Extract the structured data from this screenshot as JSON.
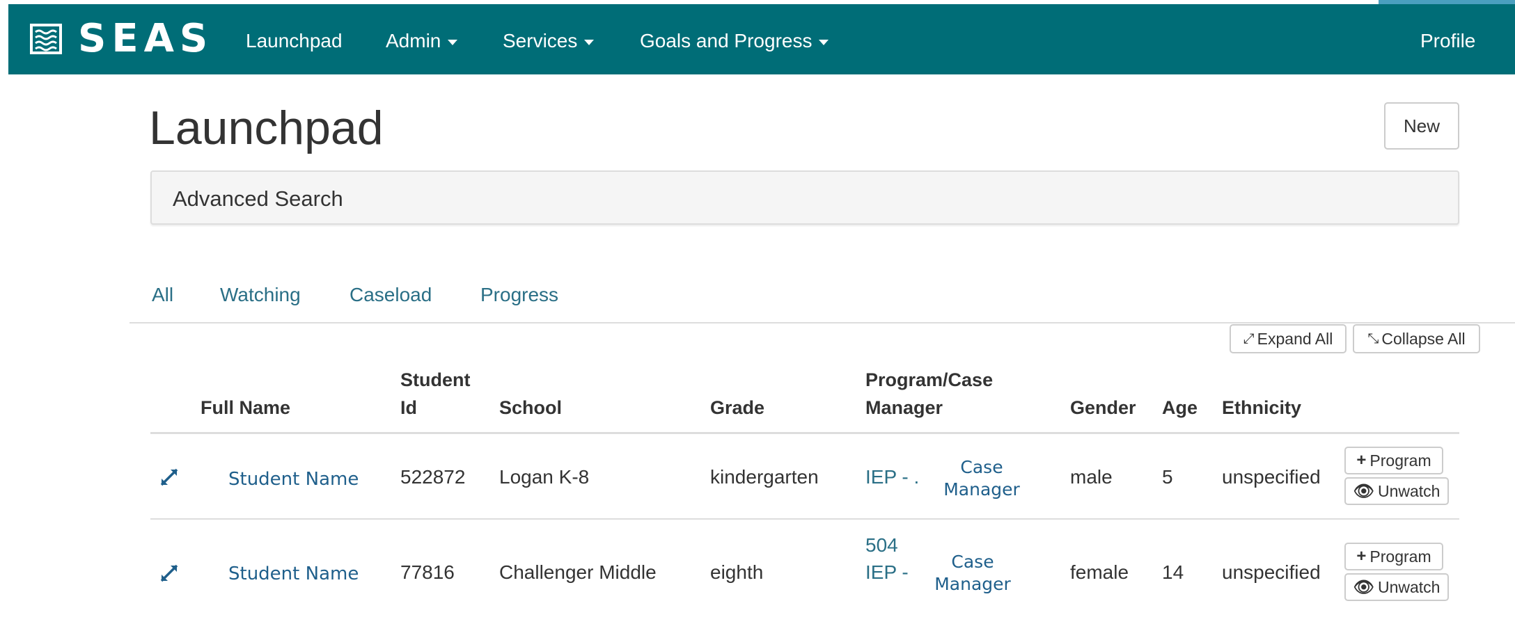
{
  "navbar": {
    "brand": "SEAS",
    "items": [
      {
        "label": "Launchpad"
      },
      {
        "label": "Admin"
      },
      {
        "label": "Services"
      },
      {
        "label": "Goals and Progress"
      }
    ],
    "profile": "Profile"
  },
  "page": {
    "title": "Launchpad",
    "new_button": "New",
    "advanced_search": "Advanced Search"
  },
  "tabs": [
    "All",
    "Watching",
    "Caseload",
    "Progress"
  ],
  "actions": {
    "expand_all": "Expand All",
    "collapse_all": "Collapse All"
  },
  "table": {
    "headers": {
      "full_name": "Full Name",
      "student_id_line1": "Student",
      "student_id_line2": "Id",
      "school": "School",
      "grade": "Grade",
      "program_line1": "Program/Case",
      "program_line2": "Manager",
      "gender": "Gender",
      "age": "Age",
      "ethnicity": "Ethnicity"
    },
    "rows": [
      {
        "name": "Student Name",
        "student_id": "522872",
        "school": "Logan K-8",
        "grade": "kindergarten",
        "program_line1": "IEP - .",
        "case_manager_line1": "Case",
        "case_manager_line2": "Manager",
        "gender": "male",
        "age": "5",
        "ethnicity": "unspecified",
        "program_button": "Program",
        "unwatch_button": "Unwatch"
      },
      {
        "name": "Student Name",
        "student_id": "77816",
        "school": "Challenger Middle",
        "grade": "eighth",
        "program_line1": "504",
        "program_line2": "IEP -",
        "case_manager_line1": "Case",
        "case_manager_line2": "Manager",
        "gender": "female",
        "age": "14",
        "ethnicity": "unspecified",
        "program_button": "Program",
        "unwatch_button": "Unwatch"
      }
    ]
  },
  "colors": {
    "navbar_bg": "#006d77",
    "link": "#2a6f86"
  },
  "icons": {
    "brand": "waves-logo-icon",
    "caret": "caret-down-icon",
    "expand": "expand-arrows-icon",
    "collapse": "collapse-arrows-icon",
    "plus": "plus-icon",
    "eye": "eye-icon"
  }
}
